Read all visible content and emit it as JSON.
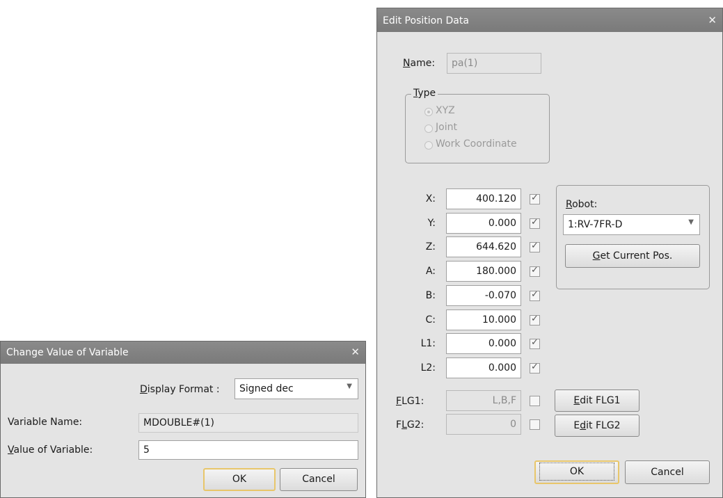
{
  "change_dialog": {
    "title": "Change Value of Variable",
    "display_format": {
      "accel": "D",
      "label_rest": "isplay Format :",
      "value": "Signed dec"
    },
    "variable_name": {
      "label": "Variable Name:",
      "value": "MDOUBLE#(1)"
    },
    "value_of_variable": {
      "accel": "V",
      "label_rest": "alue of Variable:",
      "value": "5"
    },
    "ok_label": "OK",
    "cancel_label": "Cancel"
  },
  "edit_dialog": {
    "title": "Edit Position Data",
    "name": {
      "accel": "N",
      "label_rest": "ame:",
      "value": "pa(1)"
    },
    "type_group": {
      "accel": "T",
      "label_rest": "ype",
      "options": [
        {
          "label": "XYZ",
          "selected": true
        },
        {
          "label": "Joint",
          "selected": false
        },
        {
          "label": "Work Coordinate",
          "selected": false
        }
      ]
    },
    "axes": [
      {
        "label": "X:",
        "value": "400.120",
        "checked": true
      },
      {
        "label": "Y:",
        "value": "0.000",
        "checked": true
      },
      {
        "label": "Z:",
        "value": "644.620",
        "checked": true
      },
      {
        "label": "A:",
        "value": "180.000",
        "checked": true
      },
      {
        "label": "B:",
        "value": "-0.070",
        "checked": true
      },
      {
        "label": "C:",
        "value": "10.000",
        "checked": true
      },
      {
        "label": "L1:",
        "value": "0.000",
        "checked": true
      },
      {
        "label": "L2:",
        "value": "0.000",
        "checked": true
      }
    ],
    "robot": {
      "accel": "R",
      "label_rest": "obot:",
      "value": "1:RV-7FR-D"
    },
    "get_current_pos": {
      "accel": "G",
      "label_rest": "et Current Pos."
    },
    "flg1": {
      "accel": "F",
      "label_rest": "LG1:",
      "value": "L,B,F",
      "checked": false,
      "button_accel": "E",
      "button_rest": "dit FLG1"
    },
    "flg2": {
      "label_pre": "F",
      "accel": "L",
      "label_rest": "G2:",
      "value": "0",
      "checked": false,
      "button_pre": "E",
      "button_accel": "d",
      "button_rest": "it FLG2"
    },
    "ok_label": "OK",
    "cancel_label": "Cancel"
  }
}
